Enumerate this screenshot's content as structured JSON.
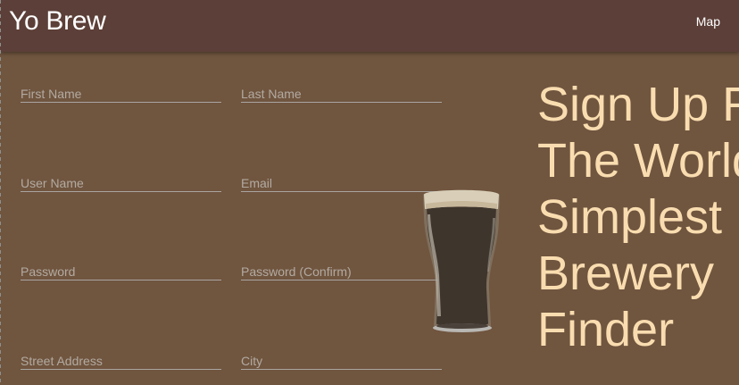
{
  "header": {
    "brand": "Yo Brew",
    "nav_map": "Map"
  },
  "form": {
    "fields": [
      {
        "label": "First Name"
      },
      {
        "label": "Last Name"
      },
      {
        "label": "User Name"
      },
      {
        "label": "Email"
      },
      {
        "label": "Password"
      },
      {
        "label": "Password (Confirm)"
      },
      {
        "label": "Street Address"
      },
      {
        "label": "City"
      }
    ]
  },
  "hero": {
    "lines": [
      "Sign Up For",
      "The World's",
      "Simplest",
      "Brewery",
      "Finder"
    ]
  },
  "colors": {
    "header_bg": "#5c3f38",
    "page_bg": "#70553f",
    "headline": "#f9ddb0",
    "field_label": "#b2aaa1",
    "beer": "#3e352d",
    "foam": "#d9cfb9"
  },
  "icons": {
    "beer_glass": "beer-glass-icon"
  }
}
